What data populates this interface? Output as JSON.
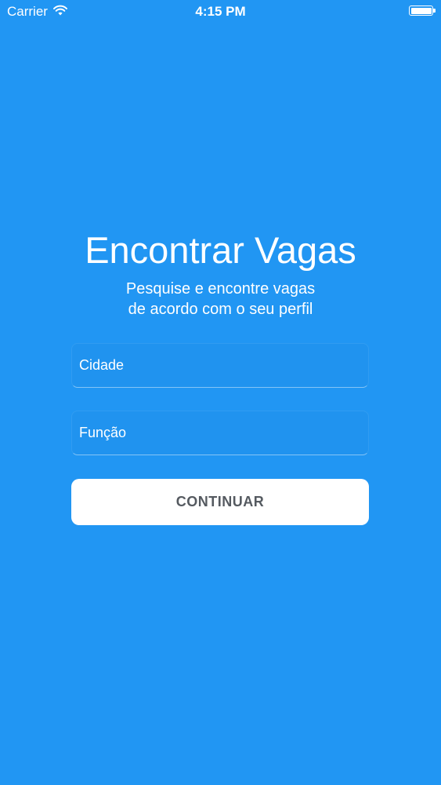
{
  "status_bar": {
    "carrier": "Carrier",
    "time": "4:15 PM",
    "wifi_icon": "wifi-icon",
    "battery_icon": "battery-icon"
  },
  "main": {
    "title": "Encontrar Vagas",
    "subtitle_line1": "Pesquise e encontre vagas",
    "subtitle_line2": "de acordo com o seu perfil",
    "city_field": {
      "placeholder": "Cidade",
      "value": ""
    },
    "role_field": {
      "placeholder": "Função",
      "value": ""
    },
    "continue_label": "CONTINUAR"
  },
  "colors": {
    "background": "#2196F3",
    "button_background": "#FFFFFF",
    "button_text": "#555A60",
    "text": "#FFFFFF"
  }
}
